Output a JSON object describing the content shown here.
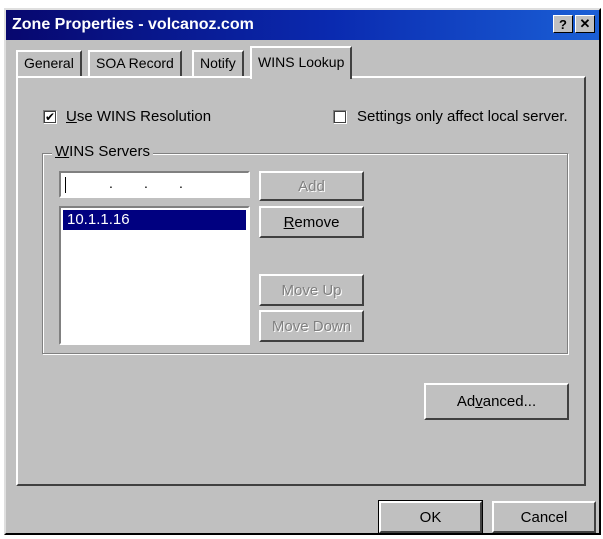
{
  "window": {
    "title": "Zone Properties - volcanoz.com",
    "help_btn": "?",
    "close_btn": "✕"
  },
  "tabs": [
    {
      "label": "General",
      "active": false
    },
    {
      "label": "SOA Record",
      "active": false
    },
    {
      "label": "Notify",
      "active": false
    },
    {
      "label": "WINS Lookup",
      "active": true
    }
  ],
  "wins": {
    "use_wins": {
      "label_pre": "",
      "label_u": "U",
      "label_post": "se WINS Resolution",
      "checked": true,
      "mark": "✔"
    },
    "local_only": {
      "label": "Settings only affect local server.",
      "checked": false
    },
    "group_title_u": "W",
    "group_title_post": "INS Servers",
    "ip_placeholder": ".        .        .",
    "servers": [
      "10.1.1.16"
    ],
    "buttons": {
      "add": "Add",
      "remove_u": "R",
      "remove_post": "emove",
      "move_up": "Move Up",
      "move_down": "Move Down"
    },
    "advanced_pre": "Ad",
    "advanced_u": "v",
    "advanced_post": "anced..."
  },
  "footer": {
    "ok": "OK",
    "cancel": "Cancel"
  }
}
